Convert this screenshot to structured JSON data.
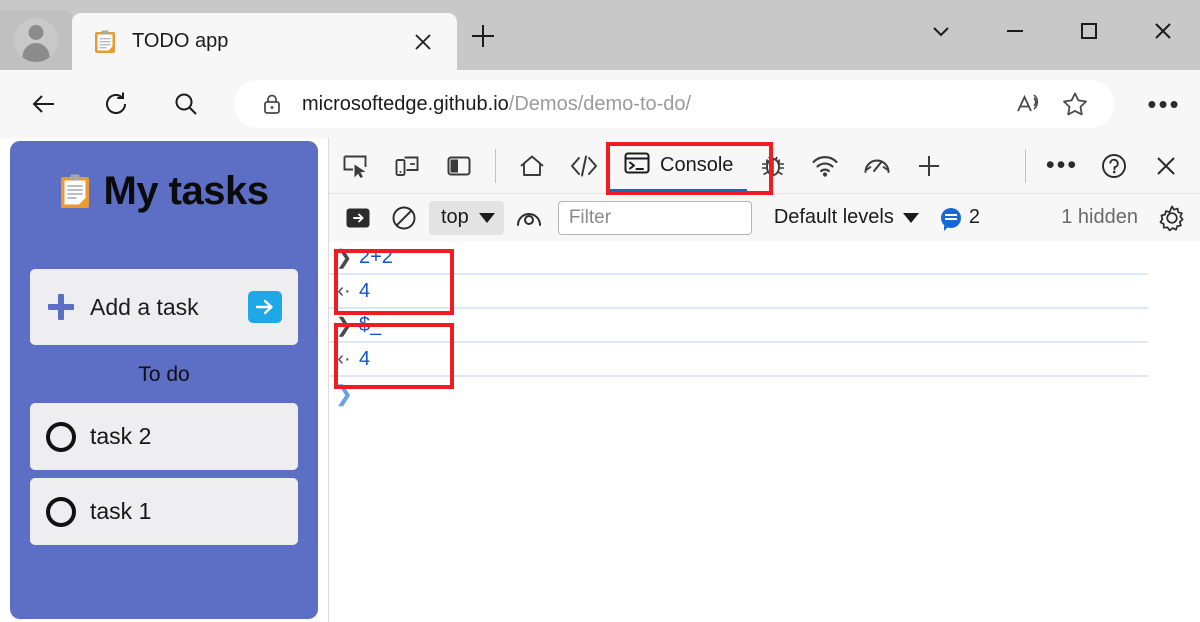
{
  "browser": {
    "profile_icon": "avatar-icon",
    "tab": {
      "favicon": "clipboard-favicon",
      "title": "TODO app",
      "close_icon": "close-icon"
    },
    "new_tab_icon": "plus-icon",
    "window_controls": {
      "tab_search_icon": "chevron-down-icon",
      "minimize_icon": "minimize-icon",
      "maximize_icon": "maximize-icon",
      "close_icon": "close-icon"
    },
    "nav": {
      "back_icon": "arrow-left-icon",
      "reload_icon": "reload-icon",
      "search_icon": "search-icon"
    },
    "omnibox": {
      "lock_icon": "lock-icon",
      "url_bold": "microsoftedge.github.io",
      "url_rest": "/Demos/demo-to-do/",
      "read_aloud_icon": "read-aloud-icon",
      "favorite_icon": "star-icon"
    },
    "settings_icon": "ellipsis-icon",
    "settings_label": "•••"
  },
  "todo_app": {
    "header_emoji": "clipboard-icon",
    "title": "My tasks",
    "add_task": {
      "plus_icon": "plus-icon",
      "label": "Add a task",
      "submit_icon": "arrow-right-icon"
    },
    "section_title": "To do",
    "tasks": [
      {
        "label": "task 2",
        "checked": false
      },
      {
        "label": "task 1",
        "checked": false
      }
    ]
  },
  "devtools": {
    "toolbar": {
      "inspect_icon": "inspect-element-icon",
      "device_icon": "device-emulation-icon",
      "dock_icon": "dock-side-icon",
      "home_icon": "home-icon",
      "elements_icon": "code-brackets-icon",
      "console_tab_icon": "console-icon",
      "console_tab_label": "Console",
      "debugger_icon": "bug-icon",
      "network_icon": "network-icon",
      "performance_icon": "gauge-icon",
      "more_tools_icon": "plus-icon",
      "more_options_icon": "ellipsis-icon",
      "more_options_label": "•••",
      "help_icon": "question-mark-icon",
      "close_icon": "close-icon"
    },
    "filterbar": {
      "sidebar_toggle_icon": "console-sidebar-icon",
      "clear_icon": "clear-console-icon",
      "context_label": "top",
      "context_caret_icon": "chevron-down-icon",
      "live_expression_icon": "eye-icon",
      "filter_placeholder": "Filter",
      "filter_value": "",
      "levels_label": "Default levels",
      "levels_caret_icon": "chevron-down-icon",
      "message_bubble_icon": "speech-bubble-icon",
      "message_count": "2",
      "hidden_count": "1 hidden",
      "settings_icon": "gear-icon"
    },
    "console": {
      "entries": [
        {
          "marker": "❯",
          "type": "input",
          "text": "2+2"
        },
        {
          "marker": "‹·",
          "type": "output",
          "text": "4"
        },
        {
          "marker": "❯",
          "type": "input",
          "text": "$_"
        },
        {
          "marker": "‹·",
          "type": "output",
          "text": "4"
        }
      ],
      "prompt_marker": "❯",
      "prompt_value": ""
    },
    "highlights": [
      {
        "name": "console-tab-highlight"
      },
      {
        "name": "console-entry-1-highlight"
      },
      {
        "name": "console-entry-2-highlight"
      }
    ]
  },
  "colors": {
    "accent_blue": "#0f6cbd",
    "highlight_red": "#ef1c23",
    "todo_purple": "#5c6fc4",
    "console_blue": "#1554c4"
  }
}
